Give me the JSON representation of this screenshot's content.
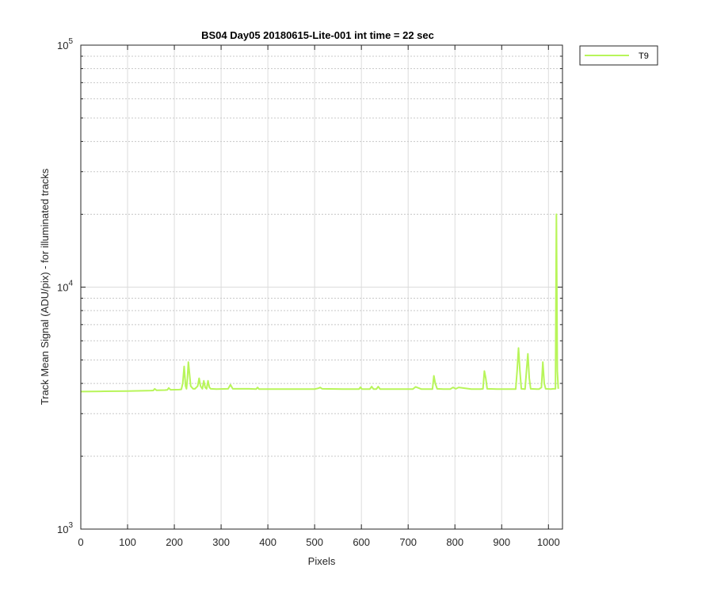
{
  "chart_data": {
    "type": "line",
    "title": "BS04 Day05 20180615-Lite-001 int time = 22 sec",
    "xlabel": "Pixels",
    "ylabel": "Track Mean Signal (ADU/pix) - for illuminated tracks",
    "xlim": [
      0,
      1030
    ],
    "ylim": [
      1000,
      100000
    ],
    "yscale": "log",
    "grid": true,
    "minor_grid_y": true,
    "legend_position": "outside-top-right",
    "x_ticks": [
      0,
      100,
      200,
      300,
      400,
      500,
      600,
      700,
      800,
      900,
      1000
    ],
    "x_tick_labels": [
      "0",
      "100",
      "200",
      "300",
      "400",
      "500",
      "600",
      "700",
      "800",
      "900",
      "1000"
    ],
    "y_ticks": [
      1000,
      10000,
      100000
    ],
    "y_tick_labels": [
      {
        "base": "10",
        "exp": "3"
      },
      {
        "base": "10",
        "exp": "4"
      },
      {
        "base": "10",
        "exp": "5"
      }
    ],
    "series": [
      {
        "name": "T9",
        "color": "#b8f55a",
        "x": [
          0,
          50,
          100,
          150,
          155,
          158,
          162,
          180,
          185,
          188,
          192,
          210,
          215,
          218,
          221,
          224,
          226,
          228,
          230,
          235,
          240,
          244,
          250,
          253,
          256,
          260,
          263,
          266,
          269,
          272,
          275,
          278,
          290,
          315,
          320,
          325,
          360,
          375,
          378,
          381,
          400,
          450,
          500,
          508,
          512,
          516,
          560,
          595,
          598,
          601,
          618,
          622,
          626,
          632,
          636,
          640,
          700,
          710,
          716,
          722,
          728,
          745,
          752,
          755,
          758,
          762,
          775,
          790,
          796,
          802,
          808,
          835,
          855,
          860,
          863,
          866,
          869,
          890,
          930,
          933,
          936,
          939,
          942,
          950,
          953,
          956,
          959,
          962,
          975,
          980,
          985,
          988,
          991,
          994,
          1005,
          1010,
          1015,
          1017,
          1019,
          1021
        ],
        "values": [
          3700,
          3710,
          3720,
          3735,
          3740,
          3800,
          3745,
          3755,
          3760,
          3830,
          3765,
          3770,
          3780,
          4000,
          4700,
          3900,
          3800,
          4200,
          4900,
          3900,
          3800,
          3800,
          3900,
          4200,
          3900,
          3800,
          4100,
          3850,
          3800,
          4100,
          3850,
          3800,
          3790,
          3800,
          3950,
          3800,
          3800,
          3790,
          3850,
          3790,
          3790,
          3790,
          3790,
          3820,
          3850,
          3800,
          3790,
          3790,
          3860,
          3790,
          3790,
          3880,
          3790,
          3790,
          3880,
          3790,
          3790,
          3790,
          3870,
          3830,
          3790,
          3790,
          3790,
          4300,
          4000,
          3800,
          3790,
          3790,
          3850,
          3800,
          3850,
          3790,
          3790,
          3800,
          4500,
          4200,
          3800,
          3790,
          3790,
          4500,
          5600,
          4500,
          3800,
          3790,
          4500,
          5300,
          4200,
          3800,
          3790,
          3790,
          3850,
          4900,
          4000,
          3800,
          3790,
          3800,
          3800,
          20000,
          4500,
          3800
        ]
      }
    ]
  }
}
